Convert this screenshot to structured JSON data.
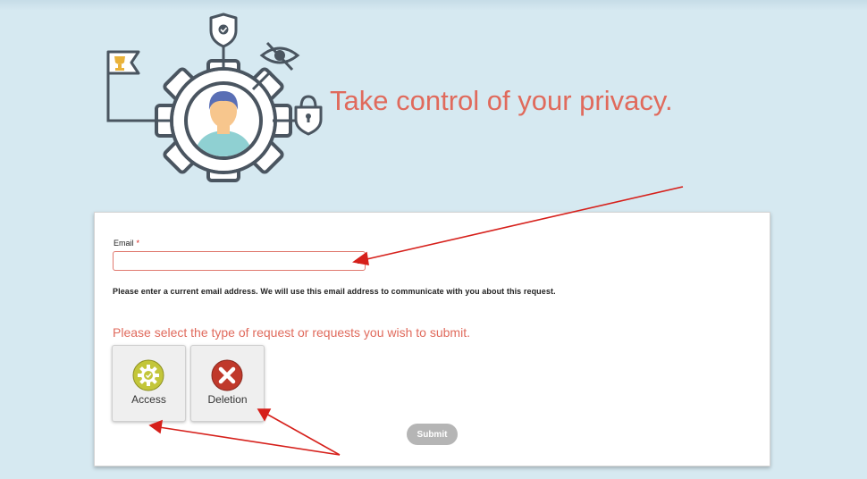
{
  "headline": "Take control of your privacy.",
  "form": {
    "email_label": "Email",
    "required_marker": "*",
    "email_value": "",
    "email_help": "Please enter a current email address. We will use this email address to communicate with you about this request.",
    "request_prompt": "Please select the type of request or requests you wish to submit.",
    "request_types": [
      {
        "label": "Access",
        "icon": "gear-check-icon",
        "color": "#c3c63a"
      },
      {
        "label": "Deletion",
        "icon": "x-circle-icon",
        "color": "#c0392b"
      }
    ],
    "submit_label": "Submit"
  },
  "colors": {
    "background": "#d6e9f1",
    "accent": "#e06a5c",
    "annotation_arrow": "#d6201b"
  }
}
